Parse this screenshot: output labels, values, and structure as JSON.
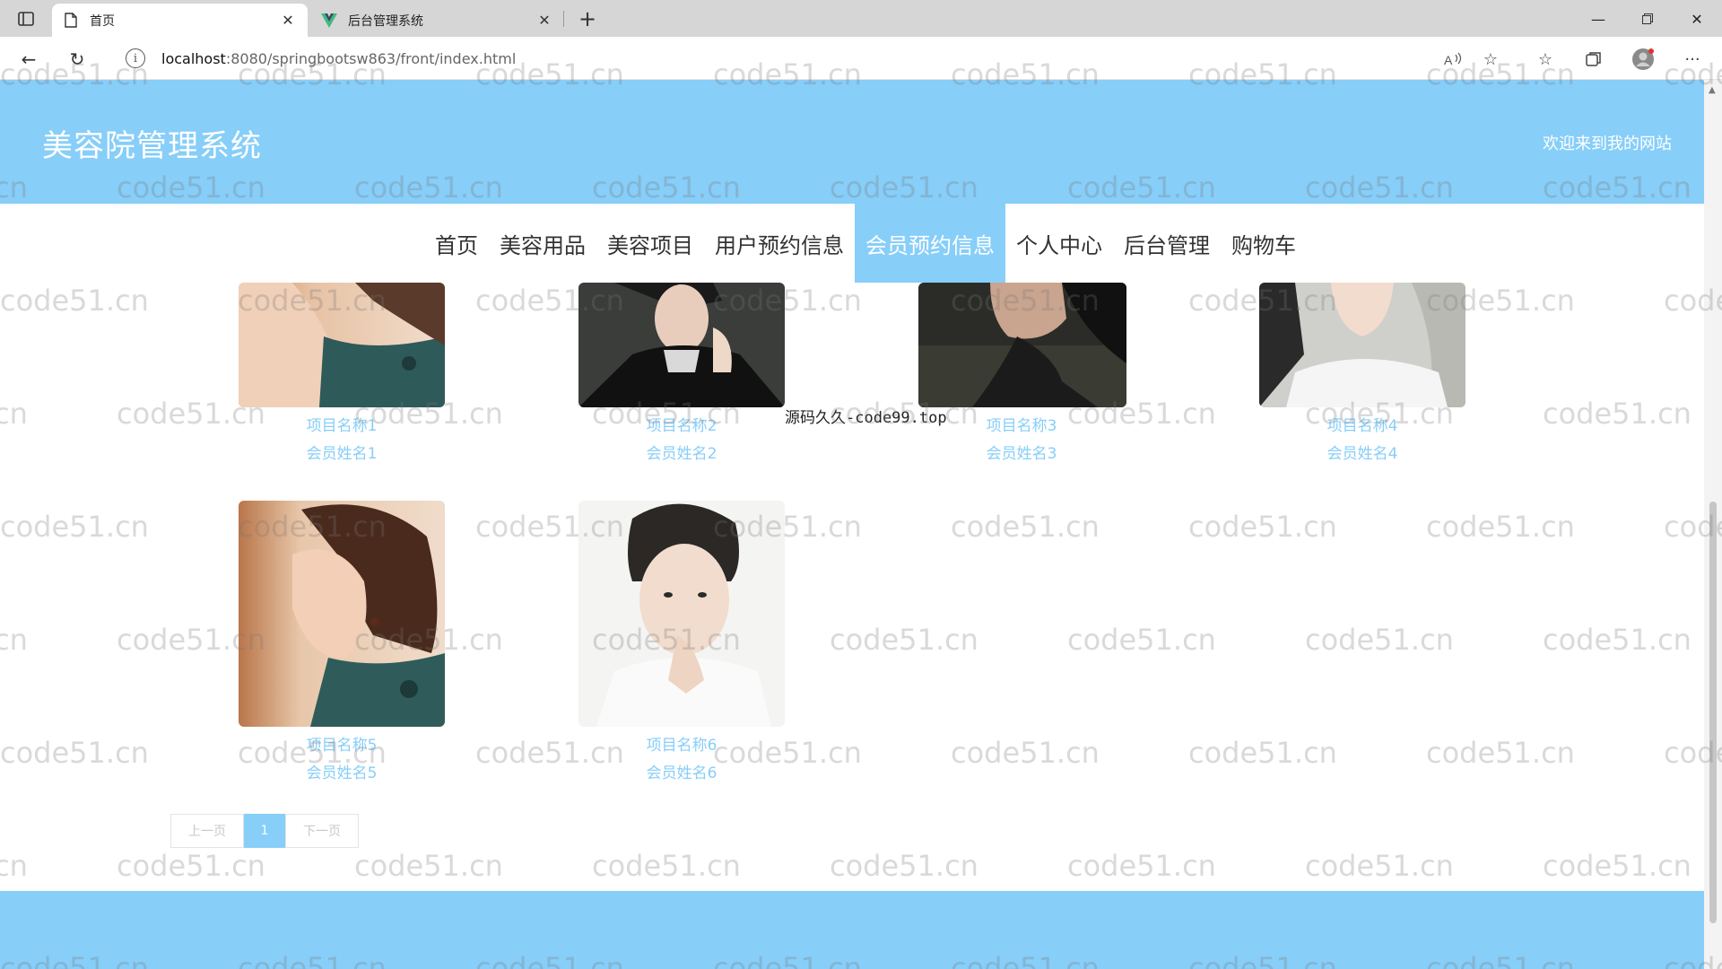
{
  "browser": {
    "tabs": [
      {
        "title": "首页",
        "active": true
      },
      {
        "title": "后台管理系统",
        "active": false
      }
    ],
    "new_tab_icon": "plus-icon",
    "url_host": "localhost",
    "url_path": ":8080/springbootsw863/front/index.html",
    "info_glyph": "i"
  },
  "site": {
    "title": "美容院管理系统",
    "welcome": "欢迎来到我的网站",
    "nav": [
      "首页",
      "美容用品",
      "美容项目",
      "用户预约信息",
      "会员预约信息",
      "个人中心",
      "后台管理",
      "购物车"
    ],
    "active_nav": "会员预约信息"
  },
  "cards": [
    {
      "name": "项目名称1",
      "member": "会员姓名1"
    },
    {
      "name": "项目名称2",
      "member": "会员姓名2"
    },
    {
      "name": "项目名称3",
      "member": "会员姓名3"
    },
    {
      "name": "项目名称4",
      "member": "会员姓名4"
    },
    {
      "name": "项目名称5",
      "member": "会员姓名5"
    },
    {
      "name": "项目名称6",
      "member": "会员姓名6"
    }
  ],
  "pager": {
    "prev": "上一页",
    "current": "1",
    "next": "下一页"
  },
  "overlay_text": "源码久久-code99.top",
  "watermark": "code51.cn",
  "colors": {
    "accent": "#87cef9",
    "link": "#87cef9"
  }
}
